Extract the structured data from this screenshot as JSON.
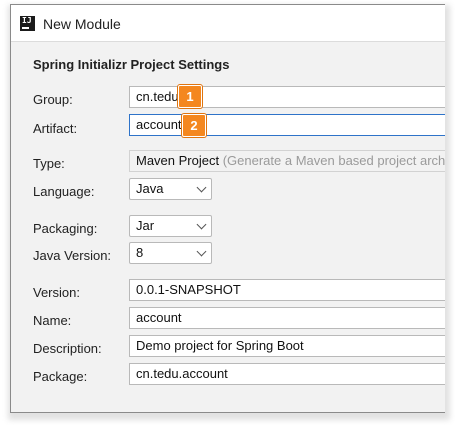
{
  "window": {
    "title": "New Module",
    "app_icon_text": "IJ"
  },
  "section": {
    "heading": "Spring Initializr Project Settings"
  },
  "fields": {
    "group": {
      "label": "Group:",
      "value": "cn.tedu"
    },
    "artifact": {
      "label": "Artifact:",
      "value": "account"
    },
    "type": {
      "label": "Type:",
      "value": "Maven Project",
      "hint": "(Generate a Maven based project archive)"
    },
    "language": {
      "label": "Language:",
      "value": "Java"
    },
    "packaging": {
      "label": "Packaging:",
      "value": "Jar"
    },
    "java_version": {
      "label": "Java Version:",
      "value": "8"
    },
    "version": {
      "label": "Version:",
      "value": "0.0.1-SNAPSHOT"
    },
    "name": {
      "label": "Name:",
      "value": "account"
    },
    "description": {
      "label": "Description:",
      "value": "Demo project for Spring Boot"
    },
    "package": {
      "label": "Package:",
      "value": "cn.tedu.account"
    }
  },
  "badges": {
    "one": "1",
    "two": "2"
  },
  "icons": {
    "app": "intellij-icon",
    "dropdown": "chevron-down-icon"
  },
  "colors": {
    "badge": "#f4871f",
    "focus_border": "#2e73c9"
  }
}
